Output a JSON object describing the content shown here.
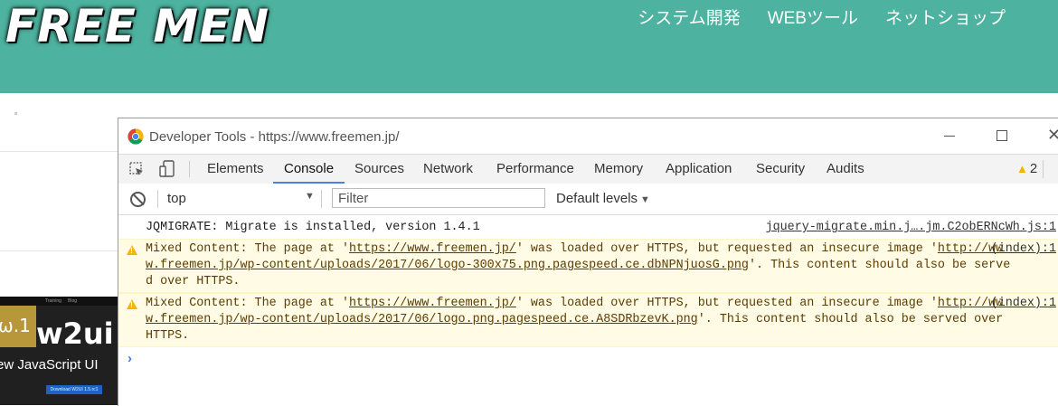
{
  "site": {
    "logo": "FREE MEN",
    "nav": [
      "システム開発",
      "WEBツール",
      "ネットショップ"
    ],
    "banner": {
      "topbar": [
        "Training",
        "Blog"
      ],
      "version": "ω.1",
      "brand": "w2ui",
      "tagline": "ew JavaScript UI",
      "button": "Download W2UI 1.5.rc1"
    }
  },
  "devtools": {
    "title": "Developer Tools - https://www.freemen.jp/",
    "tabs": [
      "Elements",
      "Console",
      "Sources",
      "Network",
      "Performance",
      "Memory",
      "Application",
      "Security",
      "Audits"
    ],
    "active_tab": "Console",
    "warning_count": "2",
    "context": "top",
    "filter_placeholder": "Filter",
    "levels": "Default levels",
    "messages": [
      {
        "type": "log",
        "text": "JQMIGRATE: Migrate is installed, version 1.4.1",
        "source": "jquery-migrate.min.j….jm.C2obERNcWh.js:1"
      },
      {
        "type": "warning",
        "prefix": "Mixed Content: The page at '",
        "page_url": "https://www.freemen.jp/",
        "middle": "' was loaded over HTTPS, but requested an insecure image '",
        "image_url": "http://www.freemen.jp/wp-content/uploads/2017/06/logo-300x75.png.pagespeed.ce.dbNPNjuosG.png",
        "suffix": "'. This content should also be served over HTTPS.",
        "source": "(index):1"
      },
      {
        "type": "warning",
        "prefix": "Mixed Content: The page at '",
        "page_url": "https://www.freemen.jp/",
        "middle": "' was loaded over HTTPS, but requested an insecure image '",
        "image_url": "http://www.freemen.jp/wp-content/uploads/2017/06/logo.png.pagespeed.ce.A8SDRbzevK.png",
        "suffix": "'. This content should also be served over HTTPS.",
        "source": "(index):1"
      }
    ],
    "prompt": "›"
  }
}
